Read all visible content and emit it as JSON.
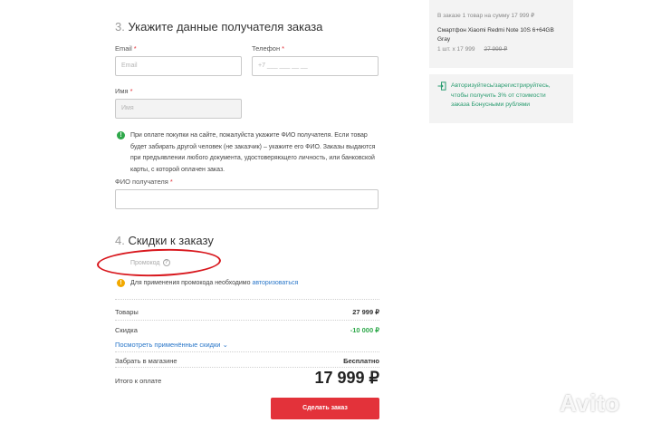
{
  "section3": {
    "num": "3.",
    "title": "Укажите данные получателя заказа"
  },
  "email": {
    "label": "Email",
    "required": "*",
    "placeholder": "Email"
  },
  "phone": {
    "label": "Телефон",
    "required": "*",
    "placeholder": "+7 ___ ___ __ __"
  },
  "name": {
    "label": "Имя",
    "required": "*",
    "placeholder": "Имя"
  },
  "notice": {
    "icon": "!",
    "text": "При оплате покупки на сайте, пожалуйста укажите ФИО получателя. Если товар будет забирать другой человек (не заказчик) – укажите его ФИО. Заказы выдаются при предъявлении любого документа, удостоверяющего личность, или банковской карты, с которой оплачен заказ."
  },
  "fio": {
    "label": "ФИО получателя",
    "required": "*"
  },
  "section4": {
    "num": "4.",
    "title": "Скидки к заказу"
  },
  "promo": {
    "label": "Промокод",
    "help_icon": "?"
  },
  "promo_notice": {
    "icon": "!",
    "text": "Для применения промокода необходимо ",
    "link": "авторизоваться"
  },
  "summary": {
    "goods_label": "Товары",
    "goods_value": "27 999 ₽",
    "discount_label": "Скидка",
    "discount_value": "-10 000 ₽",
    "discounts_link": "Посмотреть применённые скидки ⌄",
    "pickup_label": "Забрать в магазине",
    "pickup_value": "Бесплатно",
    "total_label": "Итого к оплате",
    "total_value": "17 999 ₽"
  },
  "order_button": "Сделать заказ",
  "cart": {
    "header": "В заказе 1 товар на сумму 17 999 ₽",
    "product": "Смартфон Xiaomi Redmi Note 10S 6+64GB Gray",
    "qty": "1 шт. x 17 999",
    "old_price": "27 999 ₽"
  },
  "auth_card": {
    "text": "Авторизуйтесь/зарегистрируйтесь, чтобы получить 3% от стоимости заказа Бонусными рублями",
    "icon": "login-icon"
  },
  "watermark": "Avito",
  "colors": {
    "accent_red": "#e3323a",
    "link_blue": "#2a77c9",
    "green": "#2ea84a",
    "annotation_red": "#d8161c"
  }
}
